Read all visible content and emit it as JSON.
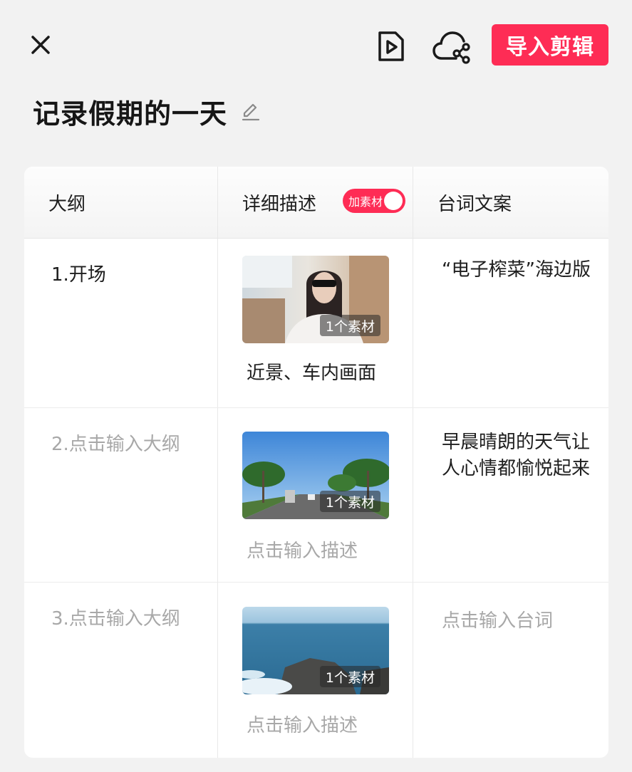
{
  "header": {
    "close_icon": "close-icon",
    "preview_icon": "play-preview-icon",
    "cloud_share_icon": "cloud-share-icon",
    "import_label": "导入剪辑",
    "accent_color": "#fe2c55"
  },
  "project": {
    "title": "记录假期的一天",
    "edit_icon": "pencil-edit-icon"
  },
  "table": {
    "headers": {
      "outline": "大纲",
      "description": "详细描述",
      "script": "台词文案"
    },
    "add_material_toggle": {
      "label": "加素材",
      "on": true
    },
    "rows": [
      {
        "outline": "1.开场",
        "outline_placeholder": false,
        "material_badge": "1个素材",
        "description": "近景、车内画面",
        "description_placeholder": false,
        "script": "“电子榨菜”海边版",
        "script_placeholder": false
      },
      {
        "outline": "2.点击输入大纲",
        "outline_placeholder": true,
        "material_badge": "1个素材",
        "description": "点击输入描述",
        "description_placeholder": true,
        "script": "早晨晴朗的天气让人心情都愉悦起来",
        "script_placeholder": false
      },
      {
        "outline": "3.点击输入大纲",
        "outline_placeholder": true,
        "material_badge": "1个素材",
        "description": "点击输入描述",
        "description_placeholder": true,
        "script": "点击输入台词",
        "script_placeholder": true
      }
    ]
  }
}
